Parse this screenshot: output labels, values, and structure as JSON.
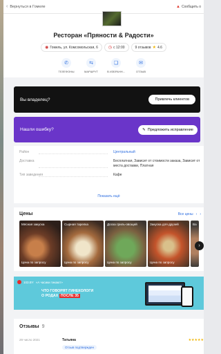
{
  "topbar": {
    "back_label": "Вернуться в Гомеле",
    "report_label": "Сообщить о"
  },
  "restaurant": {
    "title": "Ресторан «Пряности & Радости»",
    "address": "Гомель, ул. Комсомольская, 6",
    "hours": "с 12:00",
    "reviews_count": "9 отзывов",
    "rating": "4.6"
  },
  "actions": [
    {
      "label": "ТЕЛЕФОНЫ",
      "icon": "phone-icon",
      "glyph": "✆"
    },
    {
      "label": "МАРШРУТ",
      "icon": "route-icon",
      "glyph": "⇆"
    },
    {
      "label": "В ИЗБРАНН...",
      "icon": "bookmark-icon",
      "glyph": "❏"
    },
    {
      "label": "ОТЗЫВ",
      "icon": "comment-icon",
      "glyph": "✉"
    }
  ],
  "owner_card": {
    "question": "Вы владелец?",
    "button": "Привлечь клиентов"
  },
  "mistake_card": {
    "question": "Нашли ошибку?",
    "button": "Предложить исправление"
  },
  "info": {
    "rows": [
      {
        "key": "Район",
        "value": "Центральный"
      },
      {
        "key": "Доставка",
        "value": "Бесплатная, Зависит от стоимости заказа, Зависит от места доставки, Платная"
      },
      {
        "key": "Тип заведения",
        "value": "Кафе"
      }
    ],
    "show_more": "Показать ещё"
  },
  "prices": {
    "title": "Цены",
    "all_label": "Все цены",
    "tiles": [
      {
        "name": "Мясная закуска",
        "price": "Цена по запросу"
      },
      {
        "name": "Сырная тарелка",
        "price": "Цена по запросу"
      },
      {
        "name": "Доска гриль-овощей",
        "price": "Цена по запросу"
      },
      {
        "name": "Закуска для друзей",
        "price": "Цена по запросу"
      },
      {
        "name": "Ва",
        "price": ""
      }
    ]
  },
  "ad": {
    "brand": "103.BY",
    "tagline": "«А часики тикают»",
    "headline_1": "ЧТО ГОВОРЯТ ГИНЕКОЛОГИ",
    "headline_2": "О РОДАХ",
    "headline_tag": "ПОСЛЕ 35"
  },
  "reviews": {
    "title": "Отзывы",
    "count": "9",
    "items": [
      {
        "date": "29 число 2021",
        "name": "Татьяна",
        "badge": "Отзыв подтвержден",
        "stars": "★★★★★"
      }
    ]
  },
  "colors": {
    "accent": "#2f6fe0",
    "owner_bg": "#121212",
    "mistake_bg": "#6a35c9",
    "ad_bg": "#5ec9db"
  }
}
